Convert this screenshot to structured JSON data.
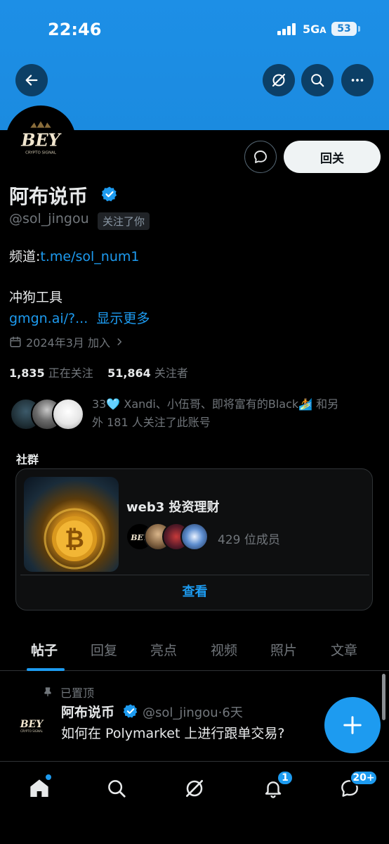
{
  "status_bar": {
    "time": "22:46",
    "network": "5G",
    "battery": "53"
  },
  "header": {
    "back_icon": "arrow-left-icon",
    "grok_icon": "slash-circle-icon",
    "search_icon": "search-icon",
    "more_icon": "more-icon"
  },
  "profile": {
    "avatar_text": "BEY",
    "avatar_subtext": "CRYPTO SIGNAL",
    "follow_button": "回关",
    "name": "阿布说币",
    "handle": "@sol_jingou",
    "follows_you": "关注了你",
    "bio_line1_prefix": "频道:",
    "bio_line1_link": "t.me/sol_num1",
    "bio_line2": "冲狗工具",
    "bio_line3_link": "gmgn.ai/?...",
    "show_more": "显示更多",
    "joined": "2024年3月 加入",
    "following_count": "1,835",
    "following_label": "正在关注",
    "followers_count": "51,864",
    "followers_label": "关注者",
    "followed_by_line1": "33🩵 Xandi、小伍哥、即将富有的Black🏄 和另",
    "followed_by_line2": "外 181 人关注了此账号"
  },
  "community": {
    "section_title": "社群",
    "name": "web3 投资理财",
    "members": "429 位成员",
    "view": "查看"
  },
  "tabs": [
    {
      "label": "帖子",
      "active": true
    },
    {
      "label": "回复"
    },
    {
      "label": "亮点"
    },
    {
      "label": "视频"
    },
    {
      "label": "照片"
    },
    {
      "label": "文章"
    }
  ],
  "post": {
    "pinned": "已置顶",
    "name": "阿布说币",
    "handle": "@sol_jingou",
    "time": "6天",
    "text": "如何在 Polymarket 上进行跟单交易?"
  },
  "bottom_nav": {
    "notifications_badge": "1",
    "messages_badge": "20+"
  },
  "colors": {
    "accent": "#1d9bf0",
    "banner": "#1d8fe6",
    "background": "#000000"
  }
}
